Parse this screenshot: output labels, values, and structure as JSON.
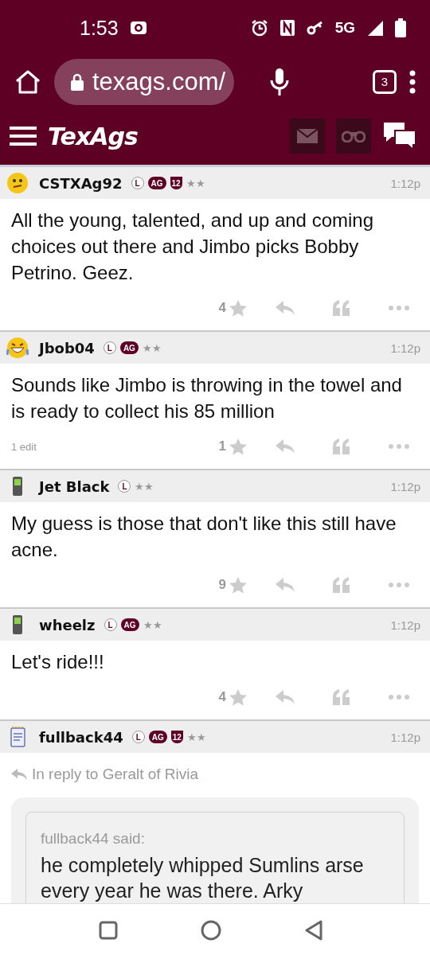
{
  "status_bar": {
    "time": "1:53",
    "network": "5G"
  },
  "browser": {
    "url": "texags.com/",
    "tab_count": "3"
  },
  "site_header": {
    "logo": "TexAgs"
  },
  "posts": [
    {
      "avatar": {
        "kind": "confused"
      },
      "username": "CSTXAg92",
      "badges": [
        {
          "kind": "circle",
          "text": "L"
        },
        {
          "kind": "pill",
          "text": "AG"
        },
        {
          "kind": "shield",
          "text": "12"
        }
      ],
      "rank": "★★",
      "time": "1:12p",
      "body": "All the young, talented, and up and coming choices out there and Jimbo picks Bobby Petrino. Geez.",
      "likes": "4"
    },
    {
      "avatar": {
        "kind": "laughing"
      },
      "username": "Jbob04",
      "badges": [
        {
          "kind": "circle",
          "text": "L"
        },
        {
          "kind": "pill",
          "text": "AG"
        }
      ],
      "rank": "★★",
      "time": "1:12p",
      "body": "Sounds like Jimbo is throwing in the towel and is ready to collect his 85 million",
      "edit_note": "1 edit",
      "likes": "1"
    },
    {
      "avatar": {
        "kind": "phone"
      },
      "username": "Jet Black",
      "badges": [
        {
          "kind": "circle",
          "text": "L"
        }
      ],
      "rank": "★★",
      "time": "1:12p",
      "body": "My guess is those that don't like this still have acne.",
      "likes": "9"
    },
    {
      "avatar": {
        "kind": "phone"
      },
      "username": "wheelz",
      "badges": [
        {
          "kind": "circle",
          "text": "L"
        },
        {
          "kind": "pill",
          "text": "AG"
        }
      ],
      "rank": "★★",
      "time": "1:12p",
      "body": "Let's ride!!!",
      "likes": "4"
    },
    {
      "avatar": {
        "kind": "notepad"
      },
      "username": "fullback44",
      "badges": [
        {
          "kind": "circle",
          "text": "L"
        },
        {
          "kind": "pill",
          "text": "AG"
        },
        {
          "kind": "shield",
          "text": "12"
        }
      ],
      "rank": "★★",
      "time": "1:12p",
      "reply_to": "In reply to Geralt of Rivia",
      "quote": {
        "author": "fullback44 said:",
        "text": "he completely whipped Sumlins arse every year he was there. Arky"
      }
    }
  ]
}
